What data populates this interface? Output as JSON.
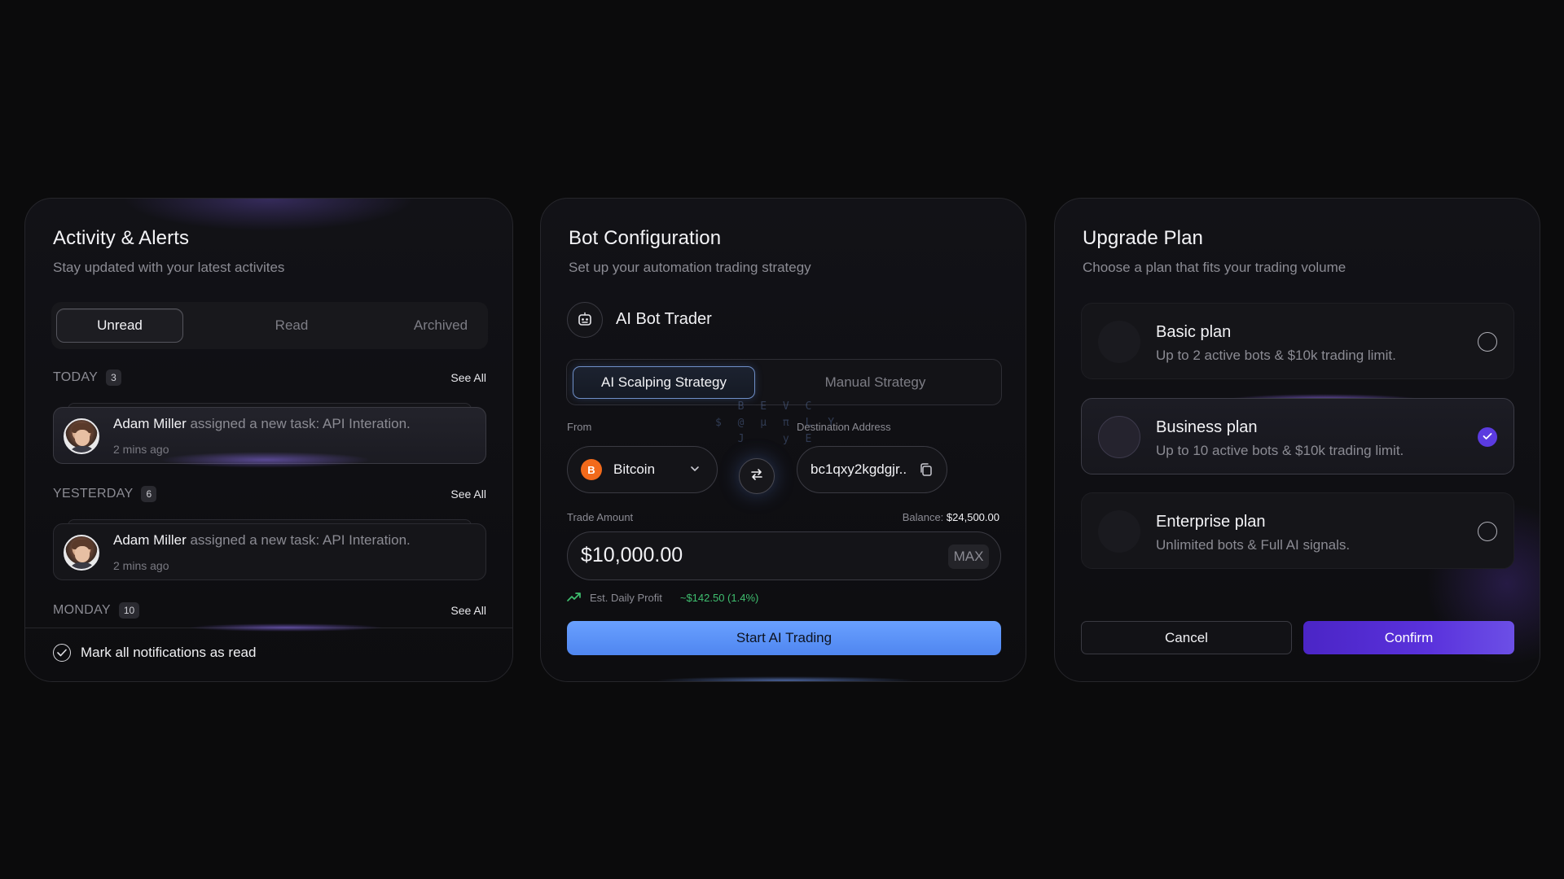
{
  "activity": {
    "title": "Activity & Alerts",
    "subtitle": "Stay updated with your latest activites",
    "tabs": [
      "Unread",
      "Read",
      "Archived"
    ],
    "active_tab": "Unread",
    "groups": [
      {
        "name": "TODAY",
        "count": "3",
        "see_all": "See All"
      },
      {
        "name": "YESTERDAY",
        "count": "6",
        "see_all": "See All"
      },
      {
        "name": "MONDAY",
        "count": "10",
        "see_all": "See All"
      }
    ],
    "notifications": [
      {
        "name": "Adam Miller",
        "text": " assigned a new task: API Interation.",
        "time": "2 mins ago"
      },
      {
        "name": "Adam Miller",
        "text": " assigned a new task: API Interation.",
        "time": "2 mins ago"
      }
    ],
    "mark_all": "Mark all notifications as read"
  },
  "bot": {
    "title": "Bot Configuration",
    "subtitle": "Set up your automation trading strategy",
    "bot_name": "AI Bot Trader",
    "strategies": [
      "AI Scalping Strategy",
      "Manual Strategy"
    ],
    "active_strategy": "AI Scalping Strategy",
    "from_label": "From",
    "from_coin": "Bitcoin",
    "coin_symbol": "B",
    "dest_label": "Destination Address",
    "dest_value": "bc1qxy2kgdgjr..",
    "trade_label": "Trade Amount",
    "balance_label": "Balance:",
    "balance_value": "$24,500.00",
    "amount": "$10,000.00",
    "max_label": "MAX",
    "profit_label": "Est. Daily Profit",
    "profit_value": "~$142.50 (1.4%)",
    "start_button": "Start AI Trading",
    "colors": {
      "accent": "#5b91f5",
      "profit": "#3fbf6f",
      "coin": "#f26a1b"
    }
  },
  "upgrade": {
    "title": "Upgrade Plan",
    "subtitle": "Choose a plan that fits your trading volume",
    "plans": [
      {
        "name": "Basic plan",
        "desc": "Up to 2 active bots & $10k trading limit.",
        "selected": false
      },
      {
        "name": "Business plan",
        "desc": "Up to 10 active bots & $10k trading limit.",
        "selected": true
      },
      {
        "name": "Enterprise plan",
        "desc": "Unlimited bots & Full AI signals.",
        "selected": false
      }
    ],
    "cancel": "Cancel",
    "confirm": "Confirm",
    "colors": {
      "confirm": "#5a32dc"
    }
  }
}
